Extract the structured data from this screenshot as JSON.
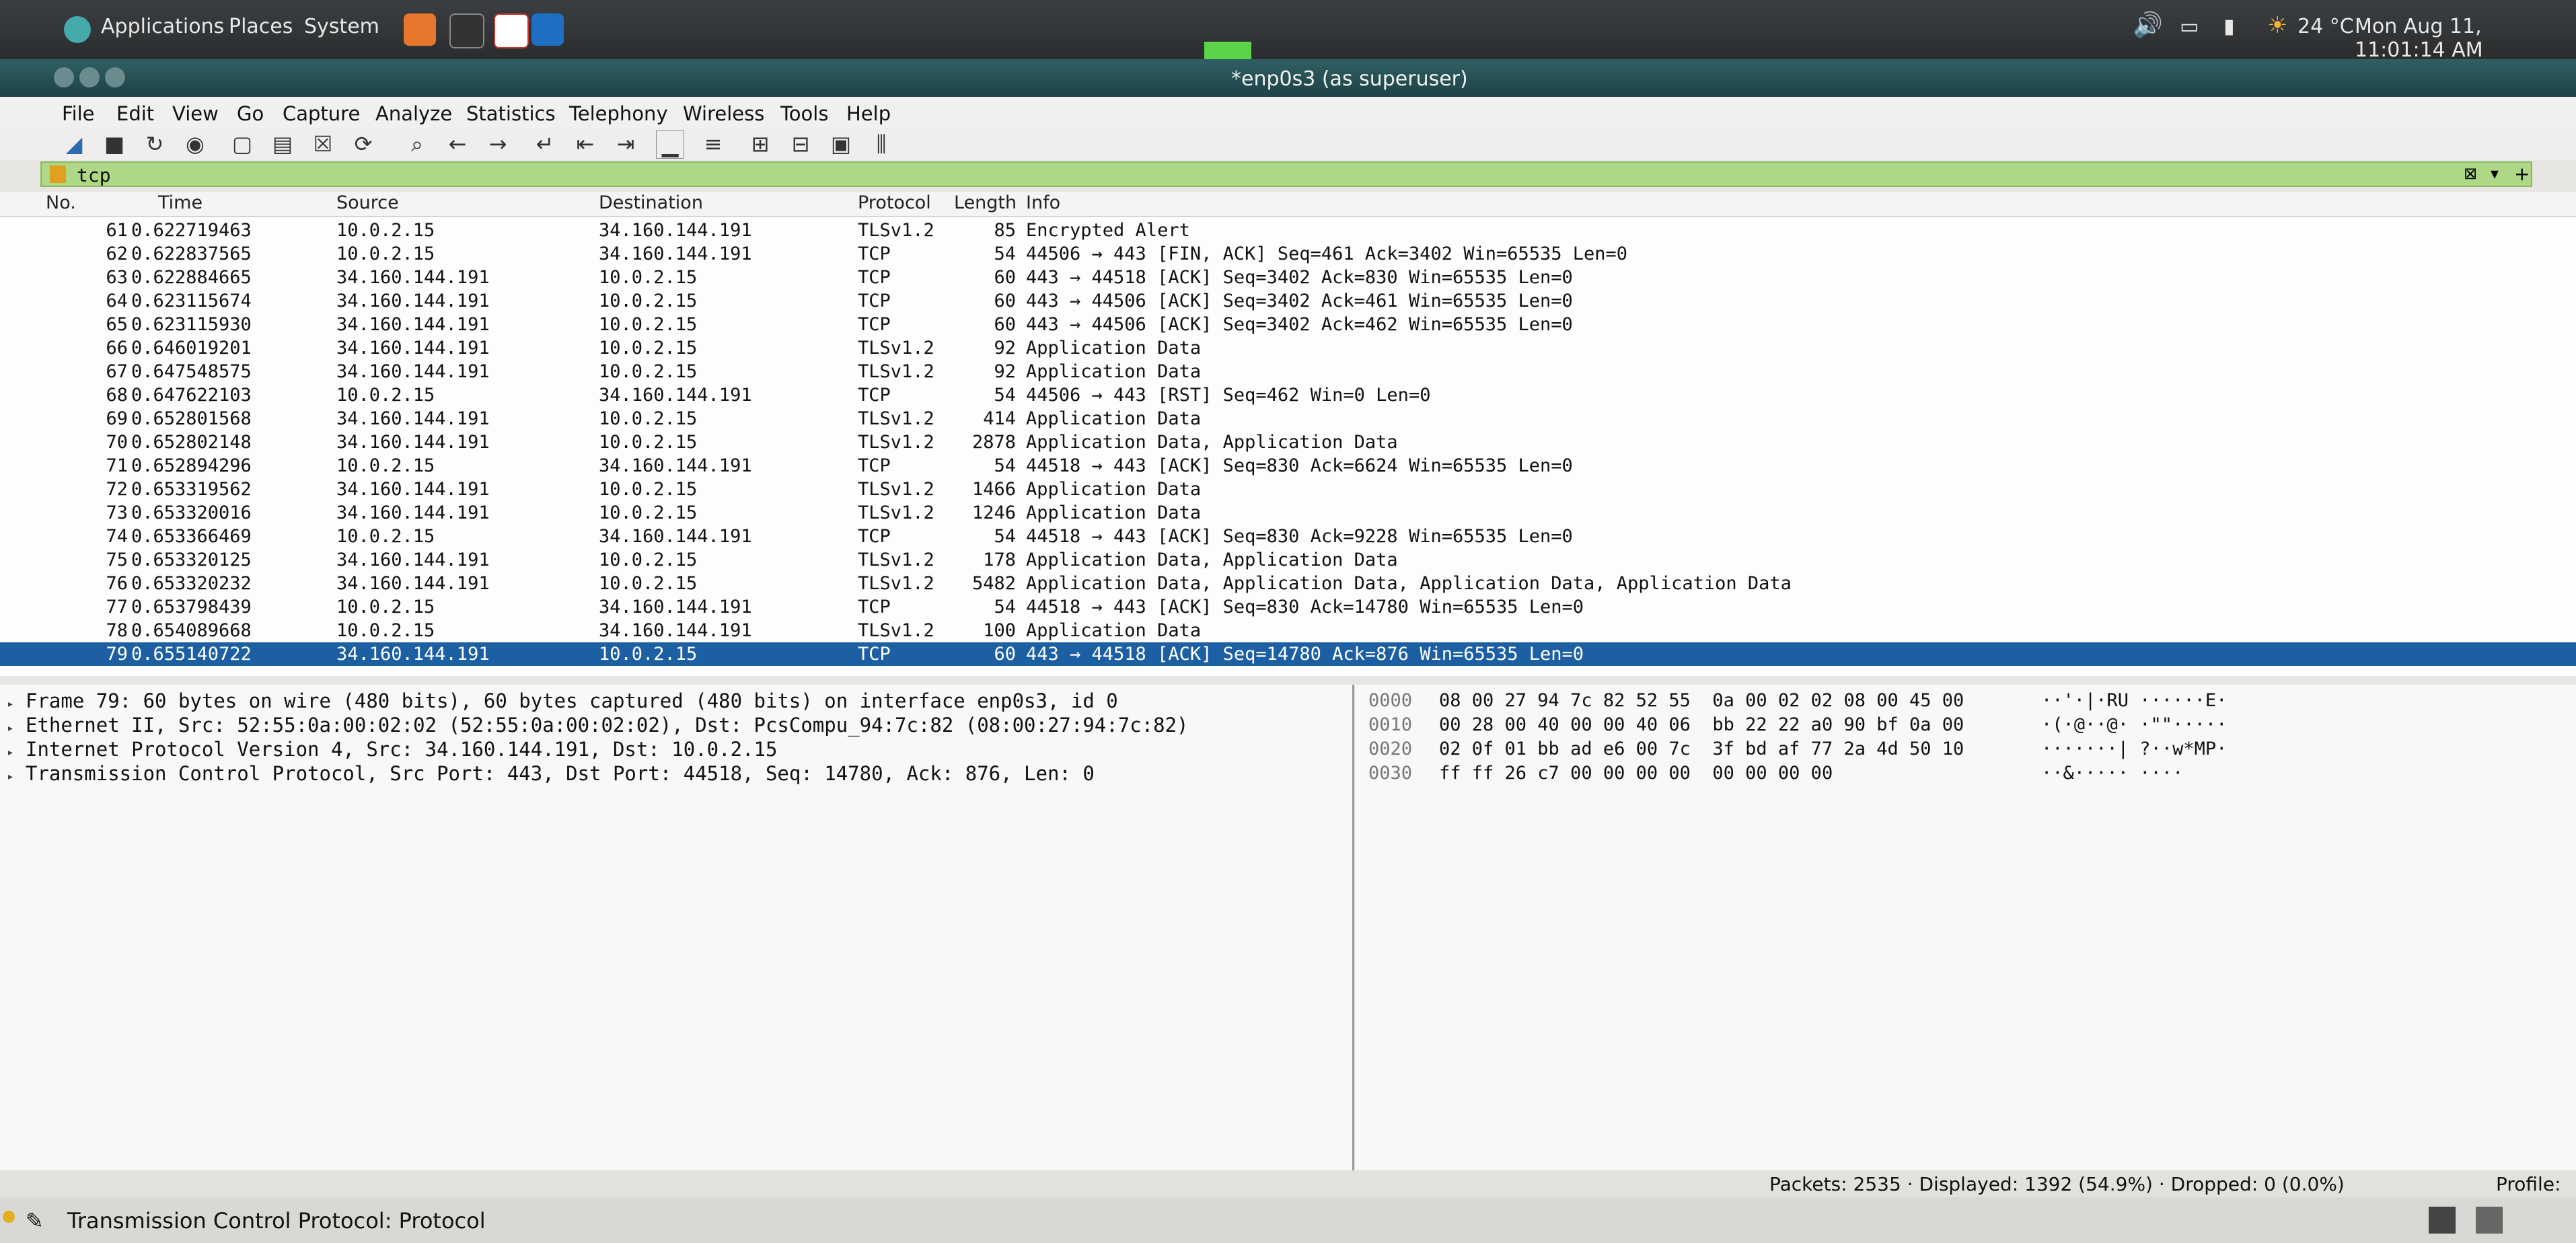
{
  "top_panel": {
    "applications": "Applications",
    "places": "Places",
    "system": "System",
    "temperature": "24 °C",
    "clock": "Mon Aug 11, 11:01:14 AM"
  },
  "window": {
    "title": "*enp0s3 (as superuser)"
  },
  "menu": [
    "File",
    "Edit",
    "View",
    "Go",
    "Capture",
    "Analyze",
    "Statistics",
    "Telephony",
    "Wireless",
    "Tools",
    "Help"
  ],
  "filter": {
    "value": "tcp"
  },
  "columns": {
    "no": "No.",
    "time": "Time",
    "source": "Source",
    "destination": "Destination",
    "protocol": "Protocol",
    "length": "Length",
    "info": "Info"
  },
  "packets": [
    {
      "no": "61",
      "time": "0.622719463",
      "src": "10.0.2.15",
      "dst": "34.160.144.191",
      "proto": "TLSv1.2",
      "len": "85",
      "info": "Encrypted Alert"
    },
    {
      "no": "62",
      "time": "0.622837565",
      "src": "10.0.2.15",
      "dst": "34.160.144.191",
      "proto": "TCP",
      "len": "54",
      "info": "44506 → 443 [FIN, ACK] Seq=461 Ack=3402 Win=65535 Len=0"
    },
    {
      "no": "63",
      "time": "0.622884665",
      "src": "34.160.144.191",
      "dst": "10.0.2.15",
      "proto": "TCP",
      "len": "60",
      "info": "443 → 44518 [ACK] Seq=3402 Ack=830 Win=65535 Len=0"
    },
    {
      "no": "64",
      "time": "0.623115674",
      "src": "34.160.144.191",
      "dst": "10.0.2.15",
      "proto": "TCP",
      "len": "60",
      "info": "443 → 44506 [ACK] Seq=3402 Ack=461 Win=65535 Len=0"
    },
    {
      "no": "65",
      "time": "0.623115930",
      "src": "34.160.144.191",
      "dst": "10.0.2.15",
      "proto": "TCP",
      "len": "60",
      "info": "443 → 44506 [ACK] Seq=3402 Ack=462 Win=65535 Len=0"
    },
    {
      "no": "66",
      "time": "0.646019201",
      "src": "34.160.144.191",
      "dst": "10.0.2.15",
      "proto": "TLSv1.2",
      "len": "92",
      "info": "Application Data"
    },
    {
      "no": "67",
      "time": "0.647548575",
      "src": "34.160.144.191",
      "dst": "10.0.2.15",
      "proto": "TLSv1.2",
      "len": "92",
      "info": "Application Data"
    },
    {
      "no": "68",
      "time": "0.647622103",
      "src": "10.0.2.15",
      "dst": "34.160.144.191",
      "proto": "TCP",
      "len": "54",
      "info": "44506 → 443 [RST] Seq=462 Win=0 Len=0"
    },
    {
      "no": "69",
      "time": "0.652801568",
      "src": "34.160.144.191",
      "dst": "10.0.2.15",
      "proto": "TLSv1.2",
      "len": "414",
      "info": "Application Data"
    },
    {
      "no": "70",
      "time": "0.652802148",
      "src": "34.160.144.191",
      "dst": "10.0.2.15",
      "proto": "TLSv1.2",
      "len": "2878",
      "info": "Application Data, Application Data"
    },
    {
      "no": "71",
      "time": "0.652894296",
      "src": "10.0.2.15",
      "dst": "34.160.144.191",
      "proto": "TCP",
      "len": "54",
      "info": "44518 → 443 [ACK] Seq=830 Ack=6624 Win=65535 Len=0"
    },
    {
      "no": "72",
      "time": "0.653319562",
      "src": "34.160.144.191",
      "dst": "10.0.2.15",
      "proto": "TLSv1.2",
      "len": "1466",
      "info": "Application Data"
    },
    {
      "no": "73",
      "time": "0.653320016",
      "src": "34.160.144.191",
      "dst": "10.0.2.15",
      "proto": "TLSv1.2",
      "len": "1246",
      "info": "Application Data"
    },
    {
      "no": "74",
      "time": "0.653366469",
      "src": "10.0.2.15",
      "dst": "34.160.144.191",
      "proto": "TCP",
      "len": "54",
      "info": "44518 → 443 [ACK] Seq=830 Ack=9228 Win=65535 Len=0"
    },
    {
      "no": "75",
      "time": "0.653320125",
      "src": "34.160.144.191",
      "dst": "10.0.2.15",
      "proto": "TLSv1.2",
      "len": "178",
      "info": "Application Data, Application Data"
    },
    {
      "no": "76",
      "time": "0.653320232",
      "src": "34.160.144.191",
      "dst": "10.0.2.15",
      "proto": "TLSv1.2",
      "len": "5482",
      "info": "Application Data, Application Data, Application Data, Application Data"
    },
    {
      "no": "77",
      "time": "0.653798439",
      "src": "10.0.2.15",
      "dst": "34.160.144.191",
      "proto": "TCP",
      "len": "54",
      "info": "44518 → 443 [ACK] Seq=830 Ack=14780 Win=65535 Len=0"
    },
    {
      "no": "78",
      "time": "0.654089668",
      "src": "10.0.2.15",
      "dst": "34.160.144.191",
      "proto": "TLSv1.2",
      "len": "100",
      "info": "Application Data"
    },
    {
      "no": "79",
      "time": "0.655140722",
      "src": "34.160.144.191",
      "dst": "10.0.2.15",
      "proto": "TCP",
      "len": "60",
      "info": "443 → 44518 [ACK] Seq=14780 Ack=876 Win=65535 Len=0",
      "selected": true
    }
  ],
  "details": [
    "Frame 79: 60 bytes on wire (480 bits), 60 bytes captured (480 bits) on interface enp0s3, id 0",
    "Ethernet II, Src: 52:55:0a:00:02:02 (52:55:0a:00:02:02), Dst: PcsCompu_94:7c:82 (08:00:27:94:7c:82)",
    "Internet Protocol Version 4, Src: 34.160.144.191, Dst: 10.0.2.15",
    "Transmission Control Protocol, Src Port: 443, Dst Port: 44518, Seq: 14780, Ack: 876, Len: 0"
  ],
  "hex": [
    {
      "offset": "0000",
      "bytes": "08 00 27 94 7c 82 52 55  0a 00 02 02 08 00 45 00",
      "ascii": "··'·|·RU ······E·"
    },
    {
      "offset": "0010",
      "bytes": "00 28 00 40 00 00 40 06  bb 22 22 a0 90 bf 0a 00",
      "ascii": "·(·@··@· ·\"\"·····"
    },
    {
      "offset": "0020",
      "bytes": "02 0f 01 bb ad e6 00 7c  3f bd af 77 2a 4d 50 10",
      "ascii": "·······| ?··w*MP·"
    },
    {
      "offset": "0030",
      "bytes": "ff ff 26 c7 00 00 00 00  00 00 00 00",
      "ascii": "··&····· ····"
    }
  ],
  "status": {
    "packets": "Packets: 2535 · Displayed: 1392 (54.9%) · Dropped: 0 (0.0%)",
    "profile": "Profile: D"
  },
  "bottom": {
    "text": "Transmission Control Protocol: Protocol"
  }
}
